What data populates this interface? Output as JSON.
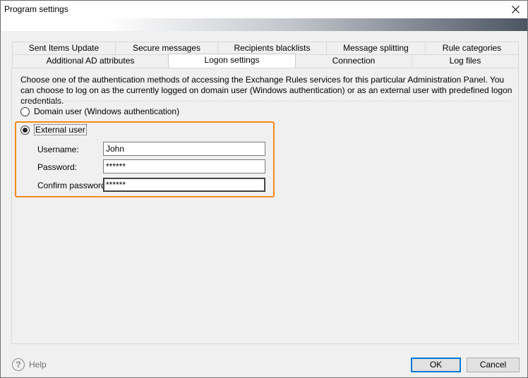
{
  "window": {
    "title": "Program settings"
  },
  "tabs": {
    "row1": [
      {
        "label": "Sent Items Update"
      },
      {
        "label": "Secure messages"
      },
      {
        "label": "Recipients blacklists"
      },
      {
        "label": "Message splitting"
      },
      {
        "label": "Rule categories"
      }
    ],
    "row2": [
      {
        "label": "Additional AD attributes"
      },
      {
        "label": "Logon settings"
      },
      {
        "label": "Connection"
      },
      {
        "label": "Log files"
      }
    ],
    "active": "Logon settings"
  },
  "logon": {
    "description": "Choose one of the authentication methods of accessing the Exchange Rules services for this particular Administration Panel. You can choose to log on as the currently logged on domain user (Windows authentication) or as an external user with predefined logon credentials.",
    "options": [
      {
        "label": "Domain user (Windows authentication)",
        "selected": false
      },
      {
        "label": "External user",
        "selected": true
      }
    ],
    "fields": {
      "username": {
        "label": "Username:",
        "value": "John"
      },
      "password": {
        "label": "Password:",
        "value": "******"
      },
      "confirm": {
        "label": "Confirm password:",
        "value": "******"
      }
    }
  },
  "footer": {
    "help": "Help",
    "ok": "OK",
    "cancel": "Cancel"
  },
  "colors": {
    "highlight": "#f58a1f",
    "accent": "#0078d7"
  }
}
